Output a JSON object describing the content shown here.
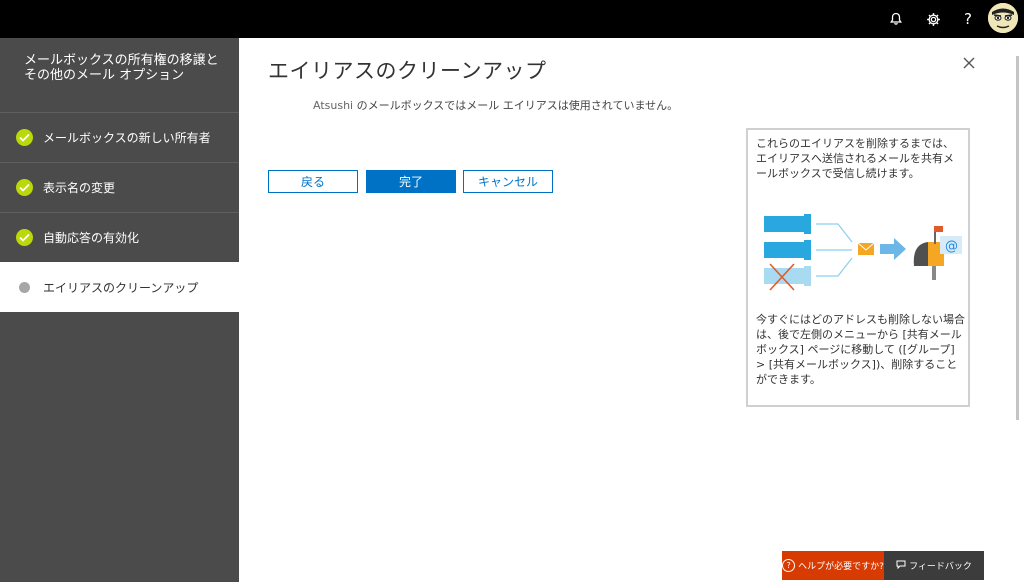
{
  "topbar": {
    "icons": [
      "bell-icon",
      "gear-icon",
      "help-icon"
    ],
    "help_glyph": "?"
  },
  "sidebar": {
    "title": "メールボックスの所有権の移譲とその他のメール オプション",
    "items": [
      {
        "label": "メールボックスの新しい所有者",
        "status": "completed"
      },
      {
        "label": "表示名の変更",
        "status": "completed"
      },
      {
        "label": "自動応答の有効化",
        "status": "completed"
      },
      {
        "label": "エイリアスのクリーンアップ",
        "status": "current"
      }
    ]
  },
  "main": {
    "title": "エイリアスのクリーンアップ",
    "info_name": "Atsushi",
    "info_text": " のメールボックスではメール エイリアスは使用されていません。",
    "buttons": {
      "back": "戻る",
      "finish": "完了",
      "cancel": "キャンセル"
    }
  },
  "helpbox": {
    "text_top": "これらのエイリアスを削除するまでは、エイリアスへ送信されるメールを共有メールボックスで受信し続けます。",
    "text_bottom": "今すぐにはどのアドレスも削除しない場合は、後で左側のメニューから [共有メールボックス] ページに移動して ([グループ] > [共有メールボックス])、削除することができます。"
  },
  "footer": {
    "help_label": "ヘルプが必要ですか?",
    "feedback_label": "フィードバック"
  },
  "colors": {
    "accent": "#0072c6",
    "check": "#bad80a",
    "help": "#d83b01",
    "sidebar": "#4b4b4b"
  }
}
